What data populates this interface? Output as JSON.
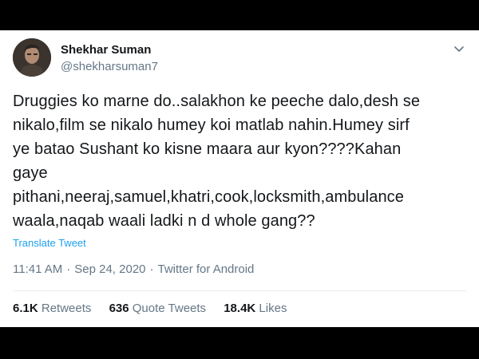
{
  "tweet": {
    "author_name": "Shekhar Suman",
    "author_handle": "@shekharsuman7",
    "text_lines": [
      "Druggies ko marne do..salakhon ke peeche dalo,desh se",
      "nikalo,film se nikalo humey koi matlab nahin.Humey sirf",
      "ye batao Sushant ko kisne maara aur kyon????Kahan",
      "gaye",
      "pithani,neeraj,samuel,khatri,cook,locksmith,ambulance",
      "waala,naqab waali ladki n d whole gang??"
    ],
    "translate_label": "Translate Tweet",
    "time": "11:41 AM",
    "date": "Sep 24, 2020",
    "source": "Twitter for Android",
    "separator": "·"
  },
  "stats": {
    "retweets_count": "6.1K",
    "retweets_label": "Retweets",
    "quote_count": "636",
    "quote_label": "Quote Tweets",
    "likes_count": "18.4K",
    "likes_label": "Likes"
  },
  "colors": {
    "background": "#000000",
    "card": "#ffffff",
    "text": "#14171a",
    "muted": "#657786",
    "link": "#1da1f2"
  },
  "icons": {
    "menu": "chevron-down-icon"
  }
}
